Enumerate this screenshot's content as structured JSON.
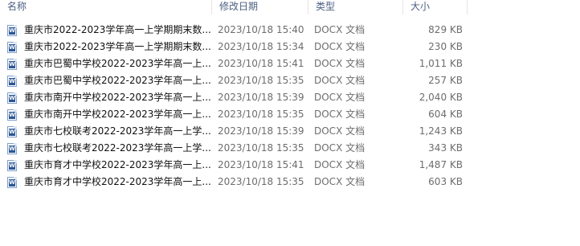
{
  "columns": {
    "name": "名称",
    "date": "修改日期",
    "type": "类型",
    "size": "大小"
  },
  "files": [
    {
      "name": "重庆市2022-2023学年高一上学期期末数...",
      "date": "2023/10/18 15:40",
      "type": "DOCX 文档",
      "size": "829 KB",
      "icon": "word-document-icon"
    },
    {
      "name": "重庆市2022-2023学年高一上学期期末数...",
      "date": "2023/10/18 15:34",
      "type": "DOCX 文档",
      "size": "230 KB",
      "icon": "word-document-icon"
    },
    {
      "name": "重庆市巴蜀中学校2022-2023学年高一上...",
      "date": "2023/10/18 15:41",
      "type": "DOCX 文档",
      "size": "1,011 KB",
      "icon": "word-document-icon"
    },
    {
      "name": "重庆市巴蜀中学校2022-2023学年高一上...",
      "date": "2023/10/18 15:35",
      "type": "DOCX 文档",
      "size": "257 KB",
      "icon": "word-document-icon"
    },
    {
      "name": "重庆市南开中学校2022-2023学年高一上...",
      "date": "2023/10/18 15:39",
      "type": "DOCX 文档",
      "size": "2,040 KB",
      "icon": "word-document-icon"
    },
    {
      "name": "重庆市南开中学校2022-2023学年高一上...",
      "date": "2023/10/18 15:35",
      "type": "DOCX 文档",
      "size": "604 KB",
      "icon": "word-document-icon"
    },
    {
      "name": "重庆市七校联考2022-2023学年高一上学...",
      "date": "2023/10/18 15:39",
      "type": "DOCX 文档",
      "size": "1,243 KB",
      "icon": "word-document-icon"
    },
    {
      "name": "重庆市七校联考2022-2023学年高一上学...",
      "date": "2023/10/18 15:35",
      "type": "DOCX 文档",
      "size": "343 KB",
      "icon": "word-document-icon"
    },
    {
      "name": "重庆市育才中学校2022-2023学年高一上...",
      "date": "2023/10/18 15:41",
      "type": "DOCX 文档",
      "size": "1,487 KB",
      "icon": "word-document-icon"
    },
    {
      "name": "重庆市育才中学校2022-2023学年高一上...",
      "date": "2023/10/18 15:35",
      "type": "DOCX 文档",
      "size": "603 KB",
      "icon": "word-document-icon"
    }
  ]
}
